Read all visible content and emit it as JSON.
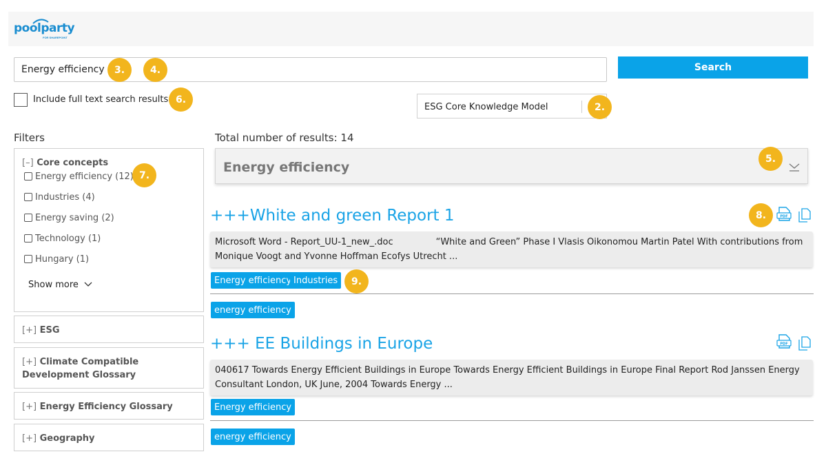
{
  "header": {
    "logo_text": "poolparty",
    "logo_sub": "FOR SHAREPOINT"
  },
  "search": {
    "value": "Energy efficiency",
    "button_label": "Search"
  },
  "fulltext": {
    "label": "Include full text search results"
  },
  "model_select": {
    "value": "ESG Core Knowledge Model"
  },
  "filters": {
    "title": "Filters",
    "core": {
      "bracket": "[–]",
      "title": "Core concepts",
      "items": [
        {
          "label": "Energy efficiency (12)"
        },
        {
          "label": "Industries (4)"
        },
        {
          "label": "Energy saving (2)"
        },
        {
          "label": "Technology (1)"
        },
        {
          "label": "Hungary (1)"
        }
      ],
      "show_more": "Show more"
    },
    "groups": [
      {
        "bracket": "[+]",
        "title": "ESG"
      },
      {
        "bracket": "[+]",
        "title": "Climate Compatible Development Glossary"
      },
      {
        "bracket": "[+]",
        "title": "Energy Efficiency Glossary"
      },
      {
        "bracket": "[+]",
        "title": "Geography"
      }
    ]
  },
  "results": {
    "total_label": "Total number of results: 14",
    "concept_select": "Energy efficiency",
    "items": [
      {
        "title": "+++White and green Report 1",
        "snippet": "Microsoft Word - Report_UU-1_new_.doc               “White and Green” Phase I Vlasis Oikonomou Martin Patel With contributions from Monique Voogt and Yvonne Hoffman Ecofys Utrecht ...",
        "tags": [
          "Energy efficiency",
          "Industries"
        ],
        "extra_tags": [
          "energy efficiency"
        ]
      },
      {
        "title": "+++ EE Buildings in Europe",
        "snippet": "040617 Towards Energy Efficient Buildings in Europe Towards Energy Efficient Buildings in Europe Final Report Rod Janssen Energy Consultant London, UK June, 2004 Towards Energy ...",
        "tags": [
          "Energy efficiency"
        ],
        "extra_tags": [
          "energy efficiency"
        ]
      }
    ]
  },
  "annotations": [
    "2.",
    "3.",
    "4.",
    "5.",
    "6.",
    "7.",
    "8.",
    "9."
  ],
  "colors": {
    "accent": "#0aa3e8",
    "link": "#19a3e6",
    "badge": "#f2b51d"
  }
}
